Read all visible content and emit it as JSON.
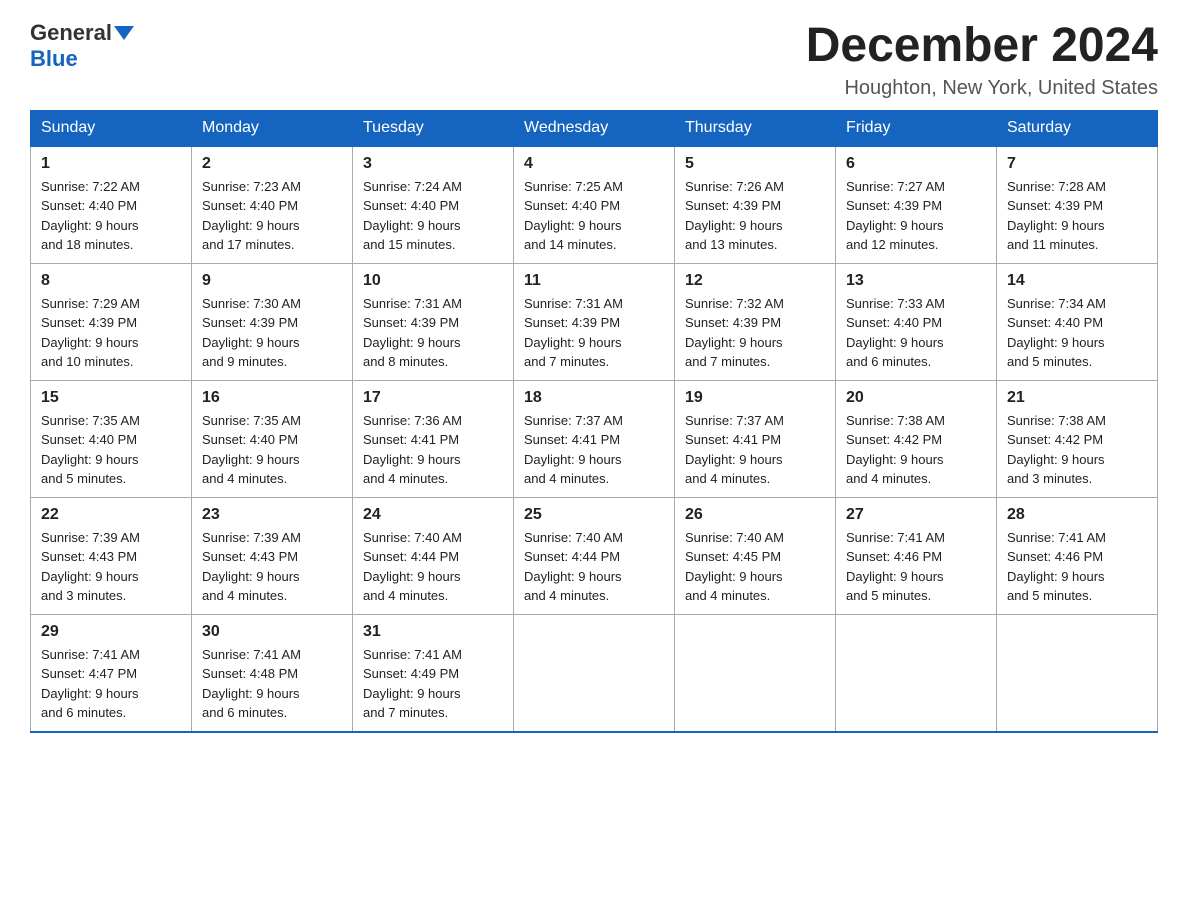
{
  "logo": {
    "general": "General",
    "blue": "Blue"
  },
  "title": "December 2024",
  "location": "Houghton, New York, United States",
  "days_of_week": [
    "Sunday",
    "Monday",
    "Tuesday",
    "Wednesday",
    "Thursday",
    "Friday",
    "Saturday"
  ],
  "weeks": [
    [
      {
        "day": "1",
        "sunrise": "7:22 AM",
        "sunset": "4:40 PM",
        "daylight": "9 hours and 18 minutes."
      },
      {
        "day": "2",
        "sunrise": "7:23 AM",
        "sunset": "4:40 PM",
        "daylight": "9 hours and 17 minutes."
      },
      {
        "day": "3",
        "sunrise": "7:24 AM",
        "sunset": "4:40 PM",
        "daylight": "9 hours and 15 minutes."
      },
      {
        "day": "4",
        "sunrise": "7:25 AM",
        "sunset": "4:40 PM",
        "daylight": "9 hours and 14 minutes."
      },
      {
        "day": "5",
        "sunrise": "7:26 AM",
        "sunset": "4:39 PM",
        "daylight": "9 hours and 13 minutes."
      },
      {
        "day": "6",
        "sunrise": "7:27 AM",
        "sunset": "4:39 PM",
        "daylight": "9 hours and 12 minutes."
      },
      {
        "day": "7",
        "sunrise": "7:28 AM",
        "sunset": "4:39 PM",
        "daylight": "9 hours and 11 minutes."
      }
    ],
    [
      {
        "day": "8",
        "sunrise": "7:29 AM",
        "sunset": "4:39 PM",
        "daylight": "9 hours and 10 minutes."
      },
      {
        "day": "9",
        "sunrise": "7:30 AM",
        "sunset": "4:39 PM",
        "daylight": "9 hours and 9 minutes."
      },
      {
        "day": "10",
        "sunrise": "7:31 AM",
        "sunset": "4:39 PM",
        "daylight": "9 hours and 8 minutes."
      },
      {
        "day": "11",
        "sunrise": "7:31 AM",
        "sunset": "4:39 PM",
        "daylight": "9 hours and 7 minutes."
      },
      {
        "day": "12",
        "sunrise": "7:32 AM",
        "sunset": "4:39 PM",
        "daylight": "9 hours and 7 minutes."
      },
      {
        "day": "13",
        "sunrise": "7:33 AM",
        "sunset": "4:40 PM",
        "daylight": "9 hours and 6 minutes."
      },
      {
        "day": "14",
        "sunrise": "7:34 AM",
        "sunset": "4:40 PM",
        "daylight": "9 hours and 5 minutes."
      }
    ],
    [
      {
        "day": "15",
        "sunrise": "7:35 AM",
        "sunset": "4:40 PM",
        "daylight": "9 hours and 5 minutes."
      },
      {
        "day": "16",
        "sunrise": "7:35 AM",
        "sunset": "4:40 PM",
        "daylight": "9 hours and 4 minutes."
      },
      {
        "day": "17",
        "sunrise": "7:36 AM",
        "sunset": "4:41 PM",
        "daylight": "9 hours and 4 minutes."
      },
      {
        "day": "18",
        "sunrise": "7:37 AM",
        "sunset": "4:41 PM",
        "daylight": "9 hours and 4 minutes."
      },
      {
        "day": "19",
        "sunrise": "7:37 AM",
        "sunset": "4:41 PM",
        "daylight": "9 hours and 4 minutes."
      },
      {
        "day": "20",
        "sunrise": "7:38 AM",
        "sunset": "4:42 PM",
        "daylight": "9 hours and 4 minutes."
      },
      {
        "day": "21",
        "sunrise": "7:38 AM",
        "sunset": "4:42 PM",
        "daylight": "9 hours and 3 minutes."
      }
    ],
    [
      {
        "day": "22",
        "sunrise": "7:39 AM",
        "sunset": "4:43 PM",
        "daylight": "9 hours and 3 minutes."
      },
      {
        "day": "23",
        "sunrise": "7:39 AM",
        "sunset": "4:43 PM",
        "daylight": "9 hours and 4 minutes."
      },
      {
        "day": "24",
        "sunrise": "7:40 AM",
        "sunset": "4:44 PM",
        "daylight": "9 hours and 4 minutes."
      },
      {
        "day": "25",
        "sunrise": "7:40 AM",
        "sunset": "4:44 PM",
        "daylight": "9 hours and 4 minutes."
      },
      {
        "day": "26",
        "sunrise": "7:40 AM",
        "sunset": "4:45 PM",
        "daylight": "9 hours and 4 minutes."
      },
      {
        "day": "27",
        "sunrise": "7:41 AM",
        "sunset": "4:46 PM",
        "daylight": "9 hours and 5 minutes."
      },
      {
        "day": "28",
        "sunrise": "7:41 AM",
        "sunset": "4:46 PM",
        "daylight": "9 hours and 5 minutes."
      }
    ],
    [
      {
        "day": "29",
        "sunrise": "7:41 AM",
        "sunset": "4:47 PM",
        "daylight": "9 hours and 6 minutes."
      },
      {
        "day": "30",
        "sunrise": "7:41 AM",
        "sunset": "4:48 PM",
        "daylight": "9 hours and 6 minutes."
      },
      {
        "day": "31",
        "sunrise": "7:41 AM",
        "sunset": "4:49 PM",
        "daylight": "9 hours and 7 minutes."
      },
      null,
      null,
      null,
      null
    ]
  ],
  "labels": {
    "sunrise": "Sunrise:",
    "sunset": "Sunset:",
    "daylight": "Daylight:"
  }
}
